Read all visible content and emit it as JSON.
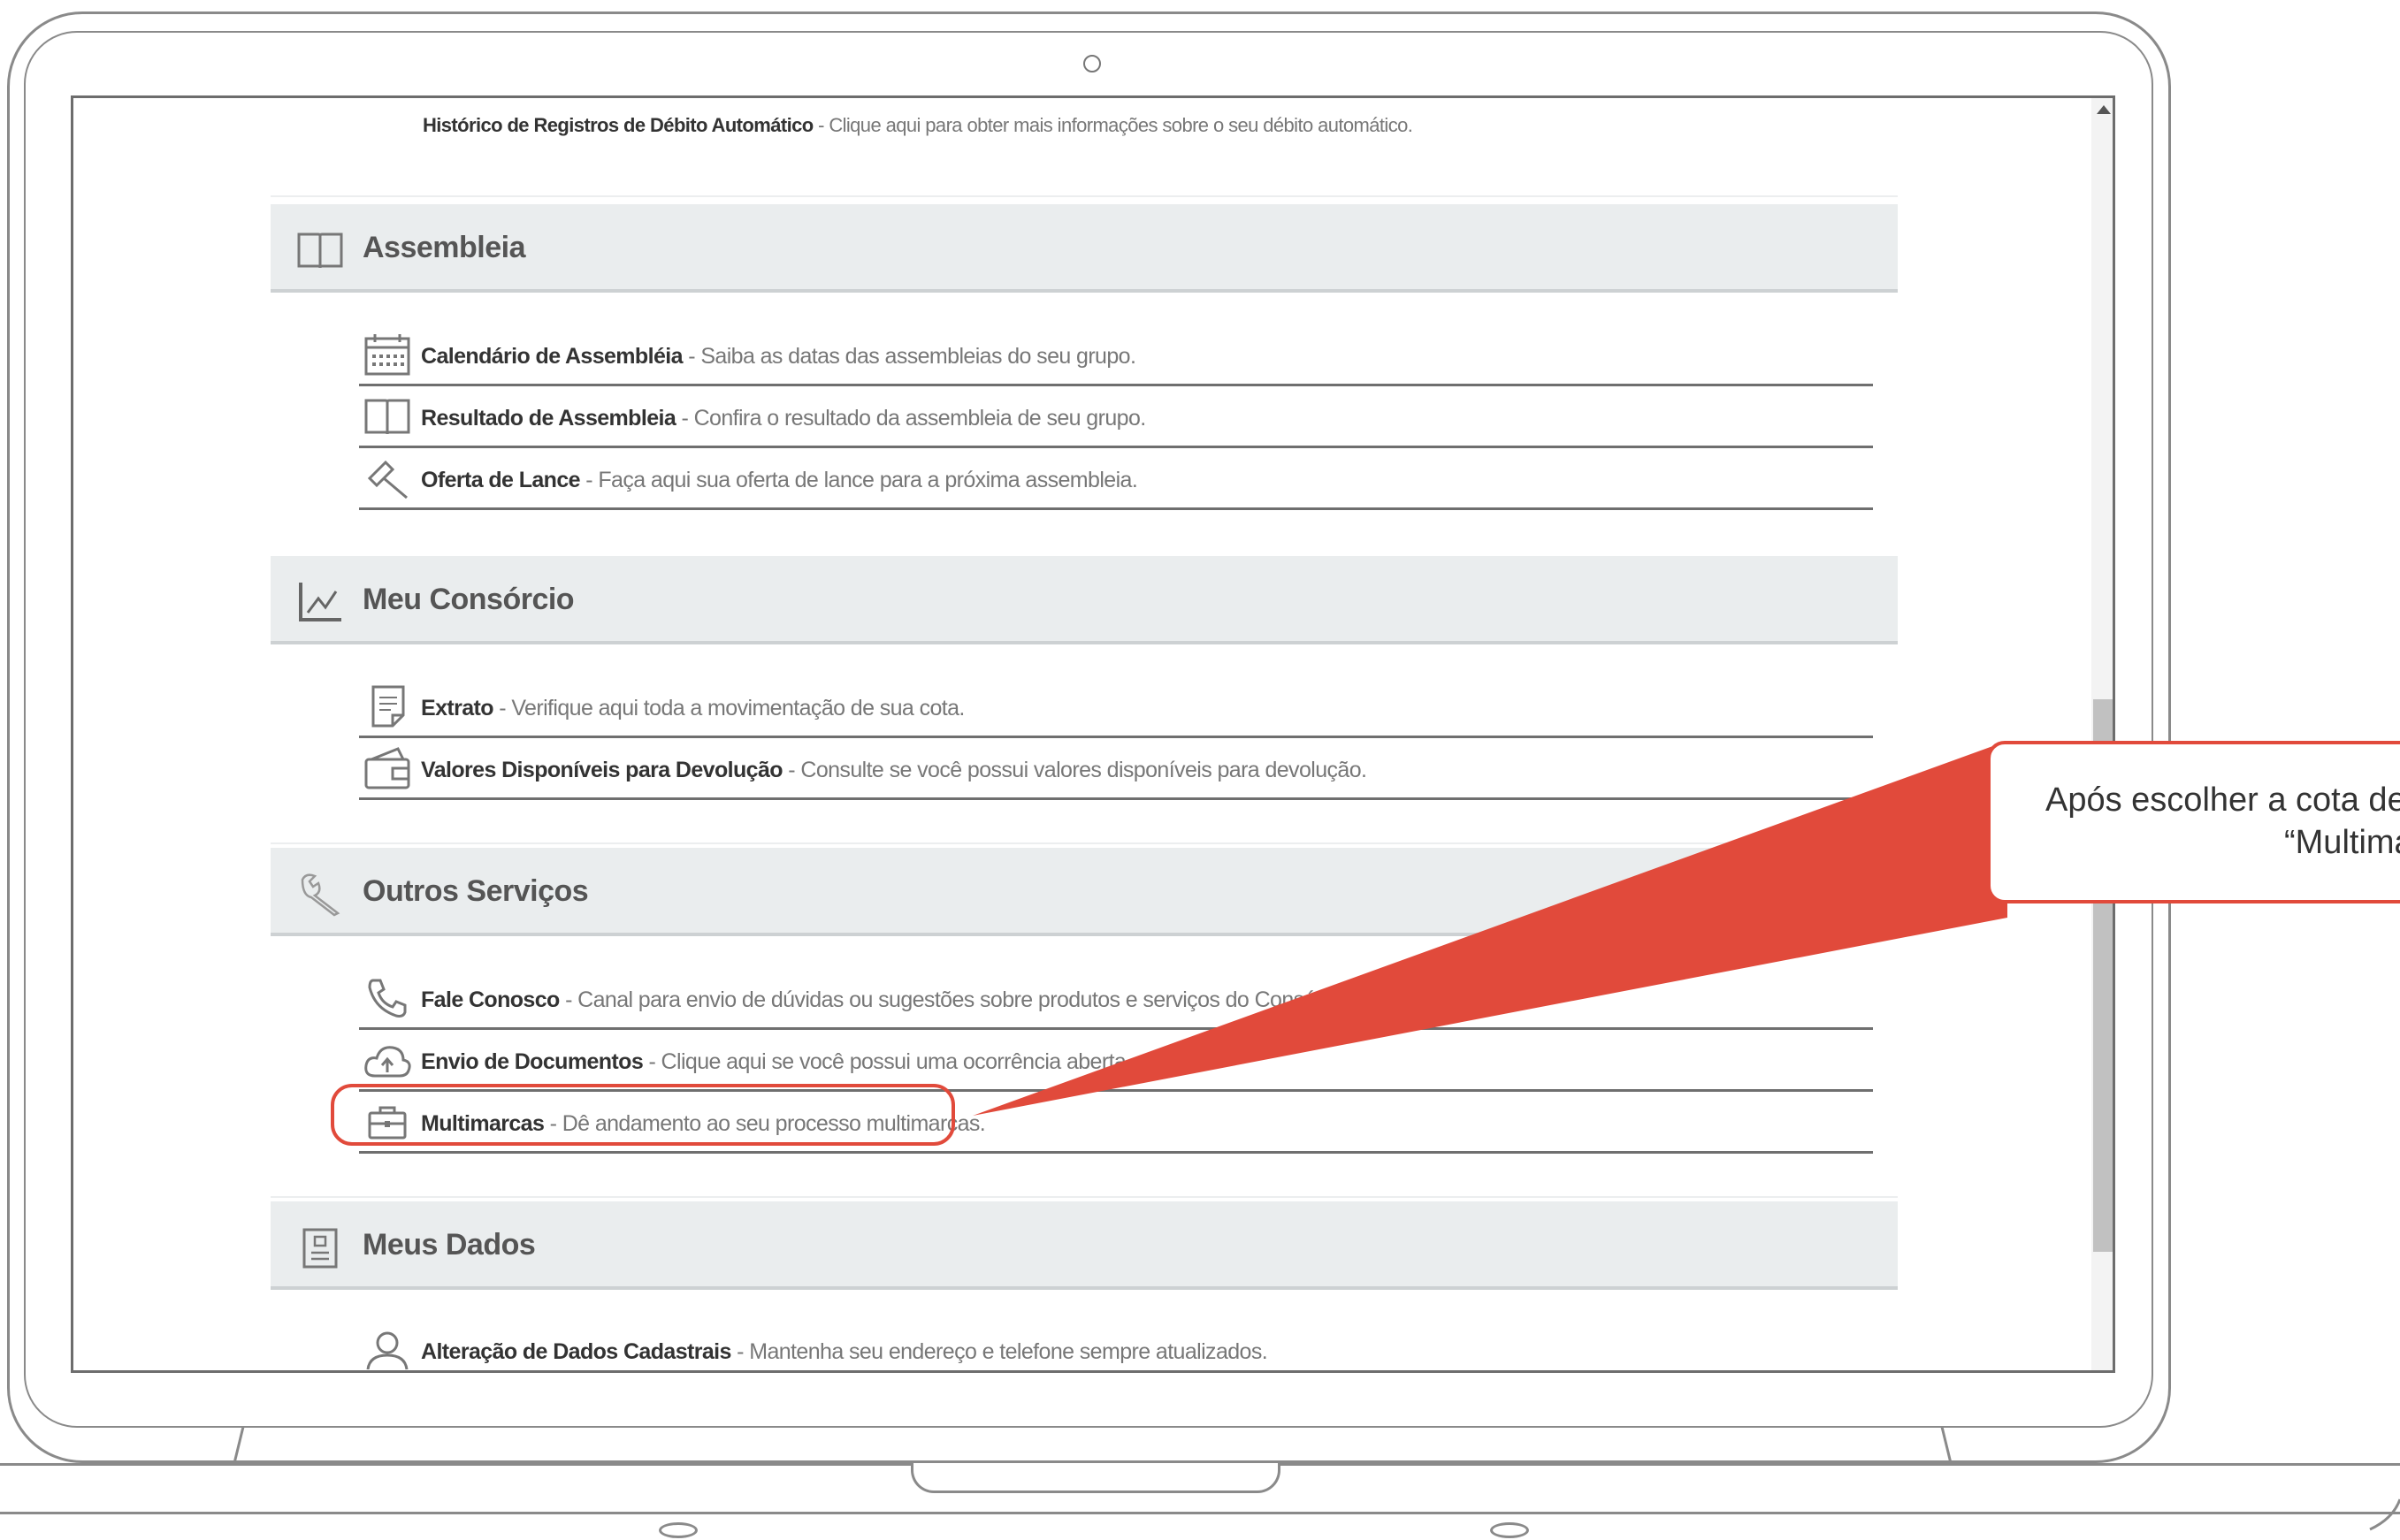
{
  "top_item": {
    "title": "Histórico de Registros de Débito Automático",
    "desc": " - Clique aqui para obter mais informações sobre o seu débito automático."
  },
  "sections": [
    {
      "title": "Assembleia",
      "icon": "book-icon",
      "items": [
        {
          "title": "Calendário de Assembléia",
          "desc": " - Saiba as datas das assembleias do seu grupo.",
          "icon": "calendar-icon"
        },
        {
          "title": "Resultado de Assembleia",
          "desc": " - Confira o resultado da assembleia de seu grupo.",
          "icon": "book-icon"
        },
        {
          "title": "Oferta de Lance",
          "desc": " - Faça aqui sua oferta de lance para a próxima assembleia.",
          "icon": "gavel-icon"
        }
      ]
    },
    {
      "title": "Meu Consórcio",
      "icon": "line-chart-icon",
      "items": [
        {
          "title": "Extrato",
          "desc": " - Verifique aqui toda a movimentação de sua cota.",
          "icon": "document-icon"
        },
        {
          "title": "Valores Disponíveis para Devolução",
          "desc": " - Consulte se você possui valores disponíveis para devolução.",
          "icon": "wallet-icon"
        }
      ]
    },
    {
      "title": "Outros Serviços",
      "icon": "wrench-icon",
      "items": [
        {
          "title": "Fale Conosco",
          "desc": " - Canal para envio de dúvidas ou sugestões sobre produtos e serviços do Consórcio Honda",
          "icon": "phone-icon"
        },
        {
          "title": "Envio de Documentos",
          "desc": " - Clique aqui se você possui uma ocorrência aberta e precisa",
          "icon": "cloud-upload-icon"
        },
        {
          "title": "Multimarcas",
          "desc": " - Dê andamento ao seu processo multimarcas.",
          "icon": "briefcase-icon"
        }
      ]
    },
    {
      "title": "Meus Dados",
      "icon": "id-card-icon",
      "items": [
        {
          "title": "Alteração de Dados Cadastrais",
          "desc": " - Mantenha seu endereço e telefone sempre atualizados.",
          "icon": "user-icon"
        }
      ]
    }
  ],
  "callout": {
    "line1": "Após escolher a cota des",
    "line2": "“Multima"
  },
  "colors": {
    "accent": "#e14a3b",
    "section_bg": "#eaedee"
  }
}
